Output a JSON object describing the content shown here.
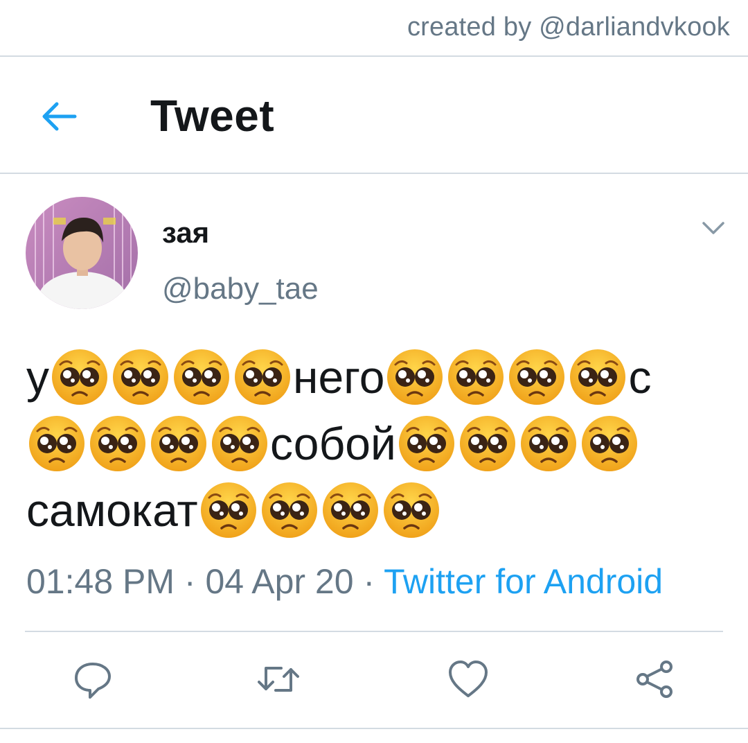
{
  "credit": "created by @darliandvkook",
  "header": {
    "title": "Tweet",
    "back_icon": "arrow-left-icon"
  },
  "tweet": {
    "author": {
      "display_name": "зая",
      "handle": "@baby_tae"
    },
    "text_lines": [
      [
        "у",
        "🥺",
        "🥺",
        "🥺",
        "🥺",
        "него",
        "🥺",
        "🥺",
        "🥺",
        "🥺",
        "с"
      ],
      [
        "🥺",
        "🥺",
        "🥺",
        "🥺",
        "собой",
        "🥺",
        "🥺",
        "🥺",
        "🥺"
      ],
      [
        "самокат",
        "🥺",
        "🥺",
        "🥺",
        "🥺"
      ]
    ],
    "meta": {
      "time": "01:48 PM",
      "separator": "·",
      "date": "04 Apr 20",
      "source": "Twitter for Android"
    }
  },
  "actions": {
    "reply_icon": "reply-icon",
    "retweet_icon": "retweet-icon",
    "like_icon": "heart-icon",
    "share_icon": "share-icon"
  },
  "colors": {
    "accent": "#1da1f2",
    "secondary_text": "#657786",
    "primary_text": "#14171a",
    "divider": "#d3dbe2"
  }
}
